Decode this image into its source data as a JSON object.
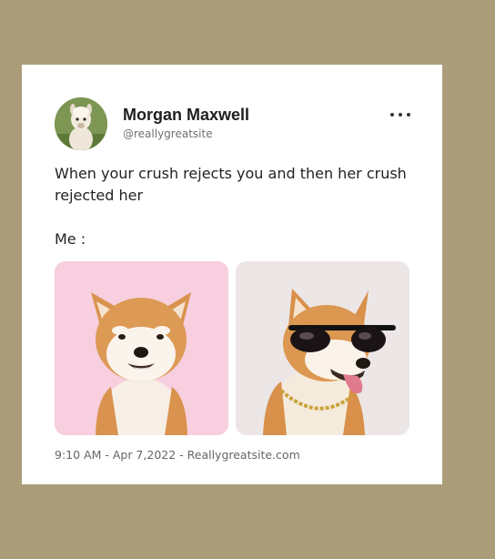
{
  "post": {
    "author_name": "Morgan Maxwell",
    "author_handle": "@reallygreatsite",
    "body_text": "When your crush rejects you and then her crush rejected her",
    "caption": "Me :",
    "meta": "9:10 AM - Apr 7,2022 - Reallygreatsite.com",
    "avatar_icon": "alpaca-avatar",
    "more_icon": "more-options-icon"
  },
  "images": [
    {
      "name": "smiling-shiba-photo",
      "background": "#f7cfdf"
    },
    {
      "name": "sunglasses-shiba-photo",
      "background": "#ece6e6"
    }
  ],
  "colors": {
    "page_background": "#ab9d7a",
    "card_background": "#ffffff",
    "name_text": "#1f1f1f",
    "muted_text": "#707070"
  }
}
